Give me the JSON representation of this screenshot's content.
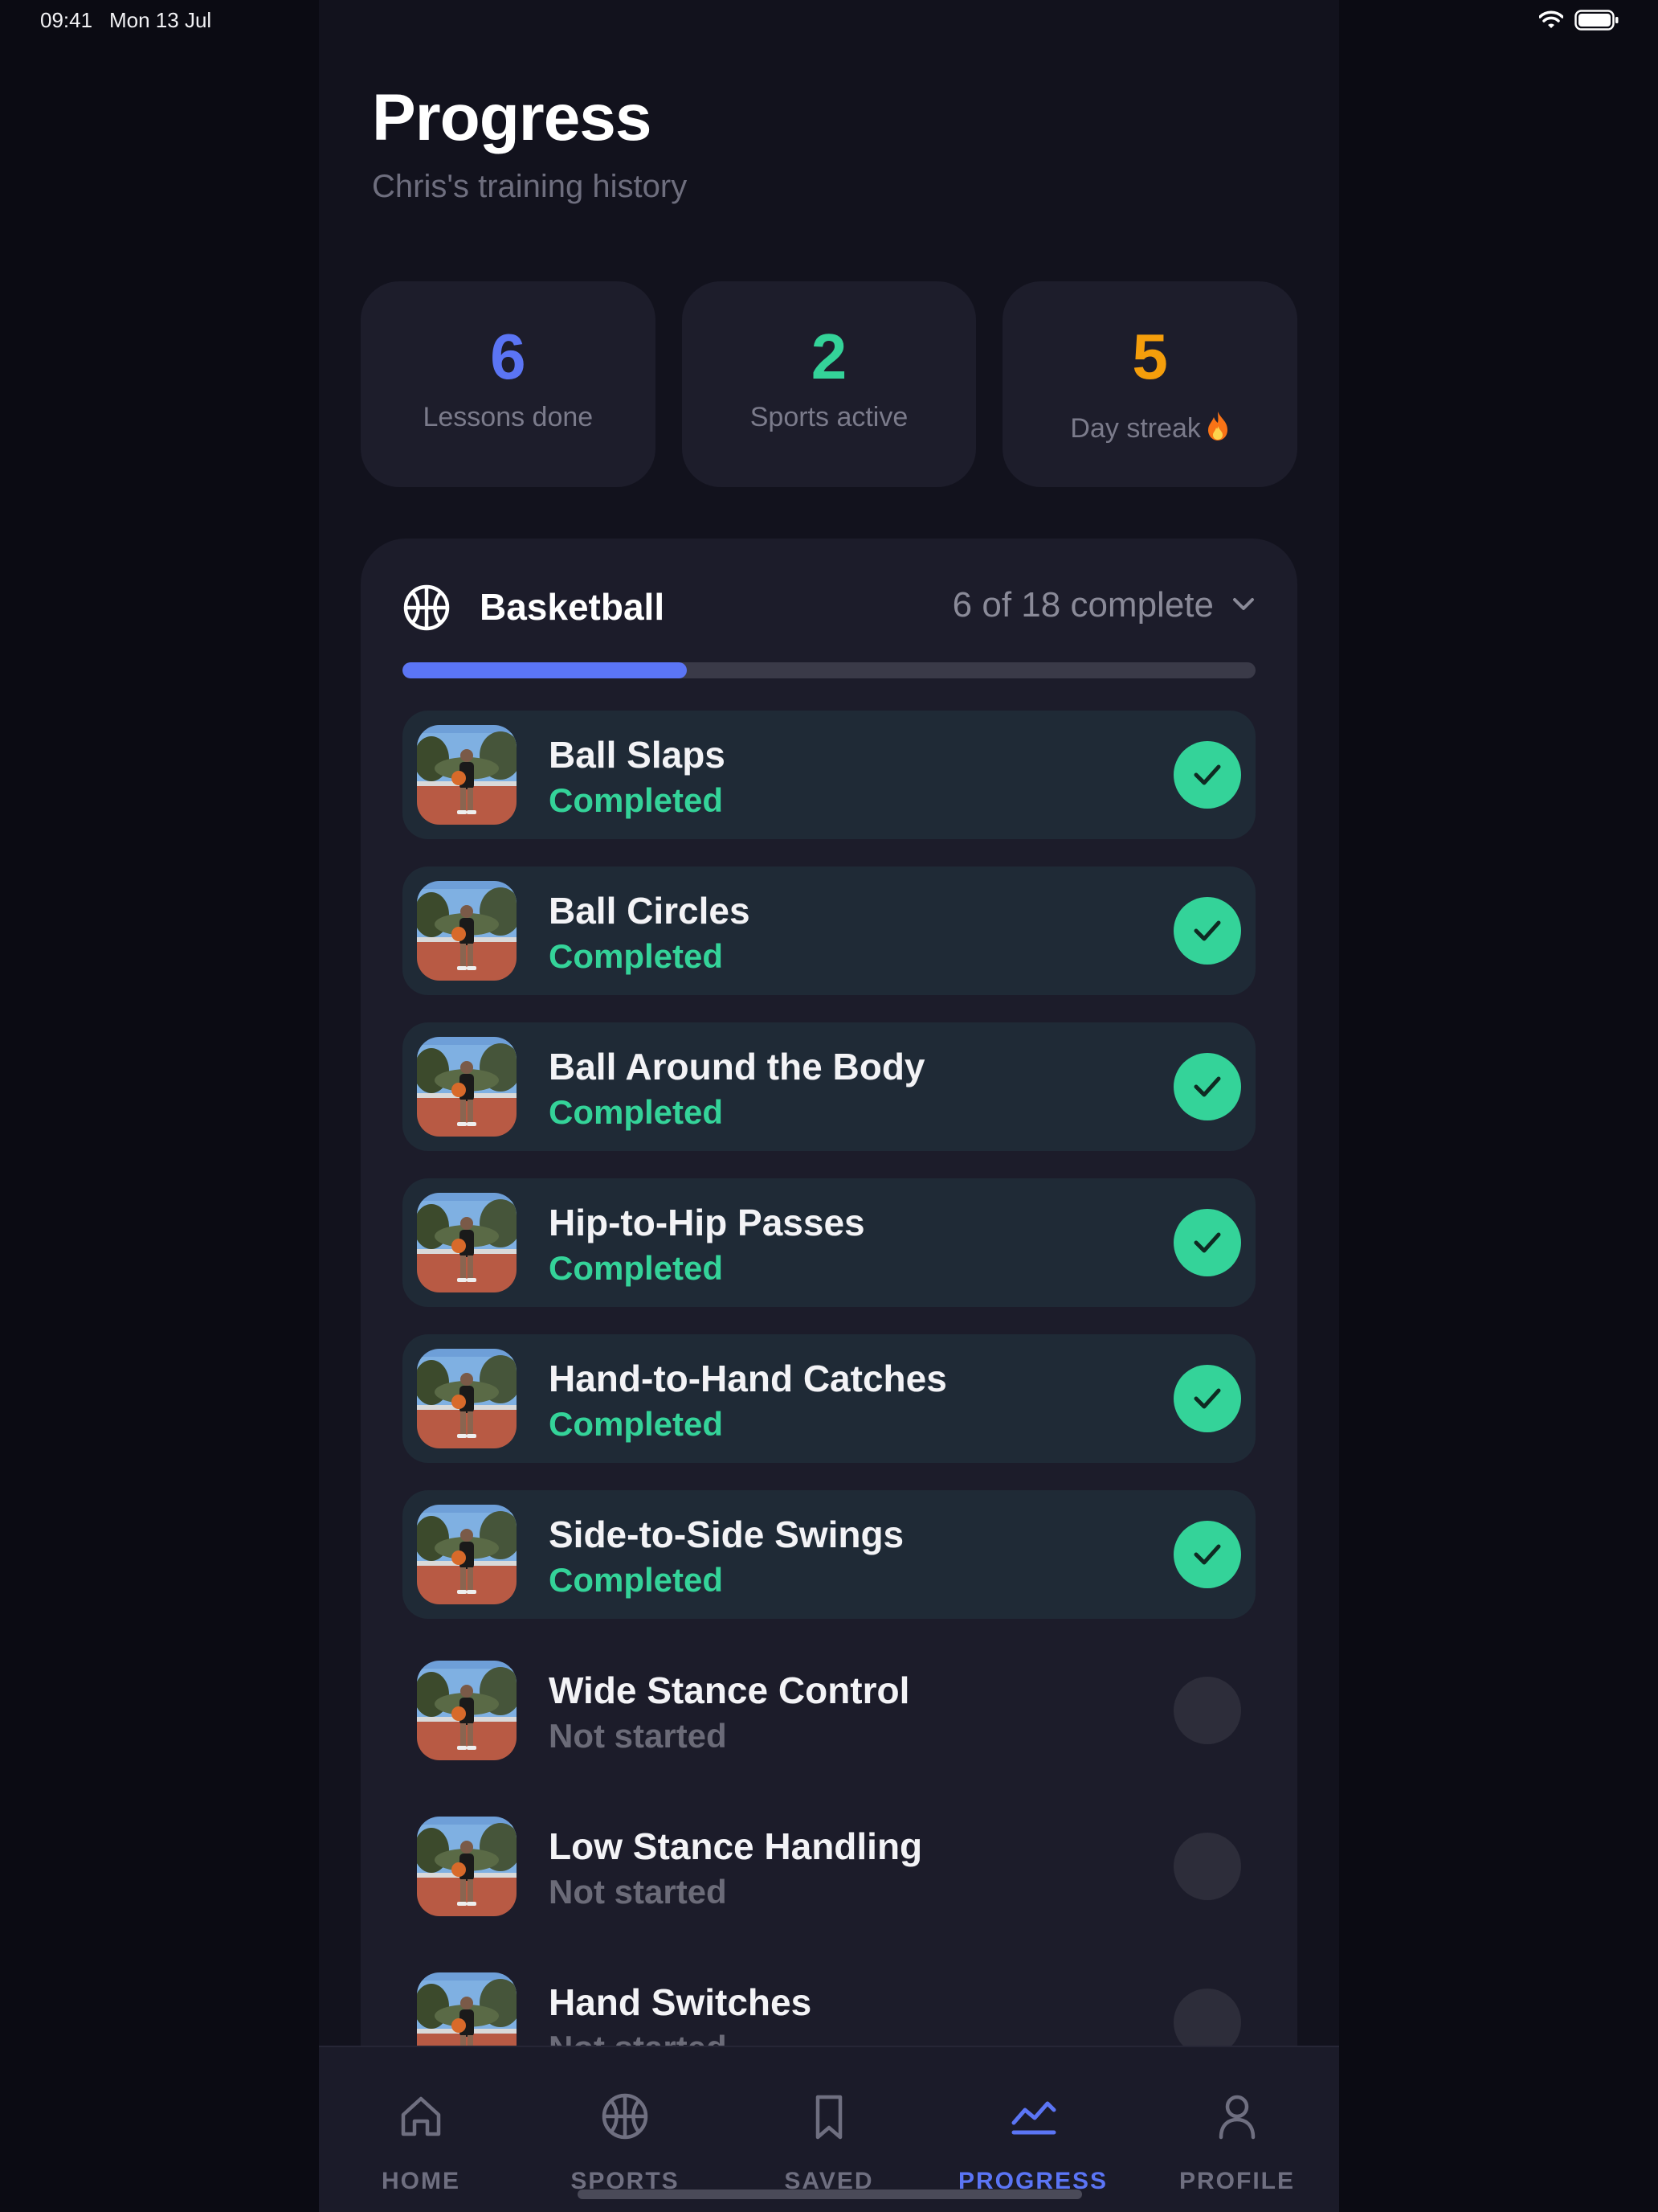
{
  "status_bar": {
    "time": "09:41",
    "date": "Mon 13 Jul"
  },
  "header": {
    "title": "Progress",
    "subtitle": "Chris's training history"
  },
  "stats": [
    {
      "value": "6",
      "label": "Lessons done",
      "color": "#5b75f5"
    },
    {
      "value": "2",
      "label": "Sports active",
      "color": "#34d399"
    },
    {
      "value": "5",
      "label": "Day streak",
      "color": "#f59e0b"
    }
  ],
  "sport": {
    "name": "Basketball",
    "count_label": "6 of 18 complete",
    "progress": 0.333,
    "icon": "basketball-icon"
  },
  "lessons": [
    {
      "title": "Ball Slaps",
      "status": "Completed",
      "done": true
    },
    {
      "title": "Ball Circles",
      "status": "Completed",
      "done": true
    },
    {
      "title": "Ball Around the Body",
      "status": "Completed",
      "done": true
    },
    {
      "title": "Hip-to-Hip Passes",
      "status": "Completed",
      "done": true
    },
    {
      "title": "Hand-to-Hand Catches",
      "status": "Completed",
      "done": true
    },
    {
      "title": "Side-to-Side Swings",
      "status": "Completed",
      "done": true
    },
    {
      "title": "Wide Stance Control",
      "status": "Not started",
      "done": false
    },
    {
      "title": "Low Stance Handling",
      "status": "Not started",
      "done": false
    },
    {
      "title": "Hand Switches",
      "status": "Not started",
      "done": false
    }
  ],
  "tabs": [
    {
      "label": "HOME",
      "icon": "home-icon",
      "active": false
    },
    {
      "label": "SPORTS",
      "icon": "basketball-icon",
      "active": false
    },
    {
      "label": "SAVED",
      "icon": "bookmark-icon",
      "active": false
    },
    {
      "label": "PROGRESS",
      "icon": "chart-line-icon",
      "active": true
    },
    {
      "label": "PROFILE",
      "icon": "person-icon",
      "active": false
    }
  ],
  "colors": {
    "accent": "#5b75f5",
    "success": "#34d399",
    "streak": "#f59e0b"
  }
}
